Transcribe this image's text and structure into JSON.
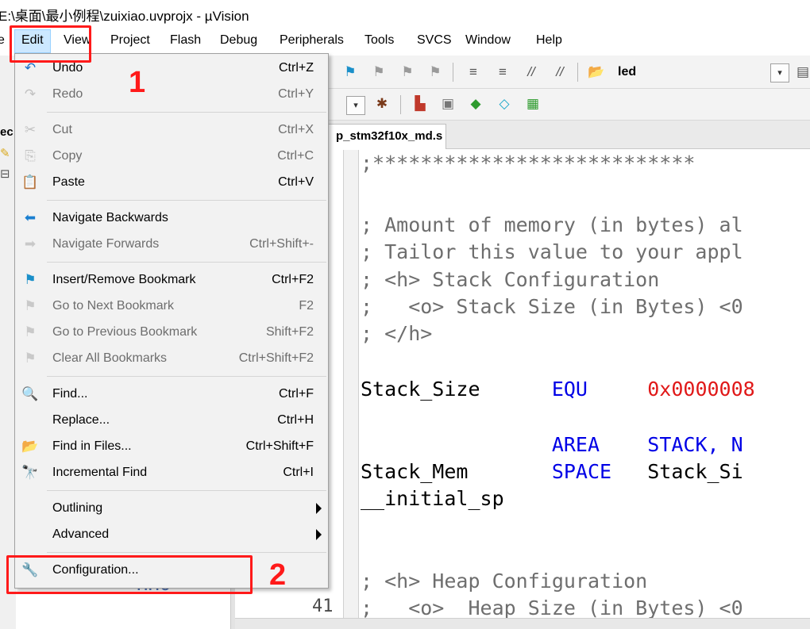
{
  "window": {
    "title": "E:\\桌面\\最小例程\\zuixiao.uvprojx - µVision"
  },
  "menubar": {
    "items": [
      {
        "label": "e"
      },
      {
        "label": "Edit"
      },
      {
        "label": "View"
      },
      {
        "label": "Project"
      },
      {
        "label": "Flash"
      },
      {
        "label": "Debug"
      },
      {
        "label": "Peripherals"
      },
      {
        "label": "Tools"
      },
      {
        "label": "SVCS"
      },
      {
        "label": "Window"
      },
      {
        "label": "Help"
      }
    ],
    "active": "Edit"
  },
  "toolbar": {
    "target_name": "led",
    "icons_row1": [
      "bookmark-icon",
      "next-bookmark-icon",
      "prev-bookmark-icon",
      "clear-bookmarks-icon",
      "indent-icon",
      "unindent-icon",
      "comment-icon",
      "uncomment-icon",
      "find-in-files-icon"
    ],
    "icons_row2": [
      "dropdown-icon",
      "debug-settings-icon",
      "manage-run-time-icon",
      "select-packs-icon",
      "pack-installer-icon",
      "component-icon",
      "event-recorder-icon"
    ]
  },
  "left_panel": {
    "fragments": [
      "ec"
    ]
  },
  "editor": {
    "active_tab": "p_stm32f10x_md.s",
    "gutter_line_number": "41",
    "code_lines": [
      {
        "text": ";***************************",
        "parts": [
          {
            "t": ";***************************",
            "c": "comment"
          }
        ]
      },
      {
        "text": "",
        "parts": []
      },
      {
        "text": "; Amount of memory (in bytes) al",
        "parts": [
          {
            "t": "; Amount of memory (in bytes) al",
            "c": "comment"
          }
        ]
      },
      {
        "text": "; Tailor this value to your appl",
        "parts": [
          {
            "t": "; Tailor this value to your appl",
            "c": "comment"
          }
        ]
      },
      {
        "text": "; <h> Stack Configuration",
        "parts": [
          {
            "t": "; <h> Stack Configuration",
            "c": "comment"
          }
        ]
      },
      {
        "text": ";   <o> Stack Size (in Bytes) <0",
        "parts": [
          {
            "t": ";   <o> Stack Size (in Bytes) <0",
            "c": "comment"
          }
        ]
      },
      {
        "text": "; </h>",
        "parts": [
          {
            "t": "; </h>",
            "c": "comment"
          }
        ]
      },
      {
        "text": "",
        "parts": []
      },
      {
        "text": "Stack_Size      EQU     0x0000008",
        "parts": [
          {
            "t": "Stack_Size      ",
            "c": "id"
          },
          {
            "t": "EQU",
            "c": "kw"
          },
          {
            "t": "     ",
            "c": "id"
          },
          {
            "t": "0x0000008",
            "c": "num"
          }
        ]
      },
      {
        "text": "",
        "parts": []
      },
      {
        "text": "                AREA    STACK, N",
        "parts": [
          {
            "t": "                ",
            "c": "id"
          },
          {
            "t": "AREA",
            "c": "kw"
          },
          {
            "t": "    ",
            "c": "id"
          },
          {
            "t": "STACK, N",
            "c": "kw"
          }
        ]
      },
      {
        "text": "Stack_Mem       SPACE   Stack_Si",
        "parts": [
          {
            "t": "Stack_Mem       ",
            "c": "id"
          },
          {
            "t": "SPACE",
            "c": "kw"
          },
          {
            "t": "   ",
            "c": "id"
          },
          {
            "t": "Stack_Si",
            "c": "id"
          }
        ]
      },
      {
        "text": "__initial_sp",
        "parts": [
          {
            "t": "__initial_sp",
            "c": "id"
          }
        ]
      },
      {
        "text": "",
        "parts": []
      },
      {
        "text": "",
        "parts": []
      },
      {
        "text": "; <h> Heap Configuration",
        "parts": [
          {
            "t": "; <h> Heap Configuration",
            "c": "comment"
          }
        ]
      },
      {
        "text": ";   <o>  Heap Size (in Bytes) <0",
        "parts": [
          {
            "t": ";   <o>  Heap Size (in Bytes) <0",
            "c": "comment"
          }
        ]
      }
    ]
  },
  "background_fragment": "HHO",
  "edit_menu": {
    "items": [
      {
        "type": "item",
        "label": "Undo",
        "shortcut": "Ctrl+Z",
        "icon": "undo-icon",
        "glyph": "↶",
        "enabled": true
      },
      {
        "type": "item",
        "label": "Redo",
        "shortcut": "Ctrl+Y",
        "icon": "redo-icon",
        "glyph": "↷",
        "enabled": false
      },
      {
        "type": "separator"
      },
      {
        "type": "item",
        "label": "Cut",
        "shortcut": "Ctrl+X",
        "icon": "cut-icon",
        "glyph": "✂",
        "enabled": false
      },
      {
        "type": "item",
        "label": "Copy",
        "shortcut": "Ctrl+C",
        "icon": "copy-icon",
        "glyph": "⎘",
        "enabled": false
      },
      {
        "type": "item",
        "label": "Paste",
        "shortcut": "Ctrl+V",
        "icon": "paste-icon",
        "glyph": "📋",
        "enabled": true
      },
      {
        "type": "separator"
      },
      {
        "type": "item",
        "label": "Navigate Backwards",
        "shortcut": "",
        "icon": "arrow-left-icon",
        "glyph": "⬅",
        "enabled": true
      },
      {
        "type": "item",
        "label": "Navigate Forwards",
        "shortcut": "Ctrl+Shift+-",
        "icon": "arrow-right-icon",
        "glyph": "➡",
        "enabled": false
      },
      {
        "type": "separator"
      },
      {
        "type": "item",
        "label": "Insert/Remove Bookmark",
        "shortcut": "Ctrl+F2",
        "icon": "bookmark-flag-icon",
        "glyph": "⚑",
        "enabled": true
      },
      {
        "type": "item",
        "label": "Go to Next Bookmark",
        "shortcut": "F2",
        "icon": "next-bookmark-icon",
        "glyph": "⚑",
        "enabled": false
      },
      {
        "type": "item",
        "label": "Go to Previous Bookmark",
        "shortcut": "Shift+F2",
        "icon": "prev-bookmark-icon",
        "glyph": "⚑",
        "enabled": false
      },
      {
        "type": "item",
        "label": "Clear All Bookmarks",
        "shortcut": "Ctrl+Shift+F2",
        "icon": "clear-bookmarks-icon",
        "glyph": "⚑",
        "enabled": false
      },
      {
        "type": "separator"
      },
      {
        "type": "item",
        "label": "Find...",
        "shortcut": "Ctrl+F",
        "icon": "find-icon",
        "glyph": "🔍",
        "enabled": true
      },
      {
        "type": "item",
        "label": "Replace...",
        "shortcut": "Ctrl+H",
        "icon": "",
        "glyph": "",
        "enabled": true
      },
      {
        "type": "item",
        "label": "Find in Files...",
        "shortcut": "Ctrl+Shift+F",
        "icon": "find-in-files-icon",
        "glyph": "📂",
        "enabled": true
      },
      {
        "type": "item",
        "label": "Incremental Find",
        "shortcut": "Ctrl+I",
        "icon": "incremental-find-icon",
        "glyph": "🔭",
        "enabled": true
      },
      {
        "type": "separator"
      },
      {
        "type": "submenu",
        "label": "Outlining",
        "enabled": true
      },
      {
        "type": "submenu",
        "label": "Advanced",
        "enabled": true
      },
      {
        "type": "separator"
      },
      {
        "type": "item",
        "label": "Configuration...",
        "shortcut": "",
        "icon": "wrench-icon",
        "glyph": "🔧",
        "enabled": true
      }
    ]
  },
  "annotations": [
    {
      "number": "1",
      "color": "#ff1a1a"
    },
    {
      "number": "2",
      "color": "#ff1a1a"
    }
  ],
  "colors": {
    "menu_bg": "#f2f2f2",
    "annotation": "#ff1a1a",
    "code_comment": "#6e6e6e",
    "code_keyword": "#0000e6",
    "code_number": "#e01818"
  }
}
